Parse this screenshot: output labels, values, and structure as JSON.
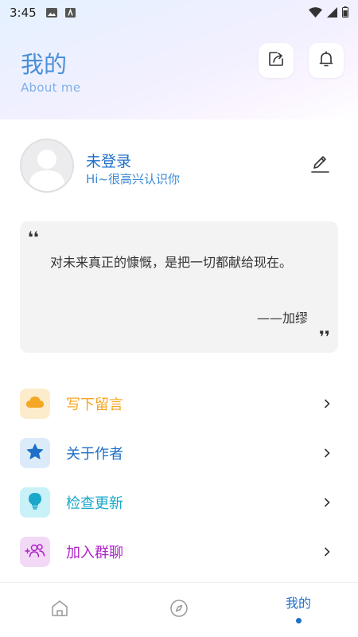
{
  "status_bar": {
    "time": "3:45"
  },
  "header": {
    "title": "我的",
    "subtitle": "About me"
  },
  "profile": {
    "name": "未登录",
    "greeting": "Hi~很高兴认识你"
  },
  "quote": {
    "open_mark": "❛❛",
    "text": "对未来真正的慷慨，是把一切都献给现在。",
    "author": "——加缪",
    "close_mark": "❜❜"
  },
  "menu": {
    "items": [
      {
        "label": "写下留言",
        "icon": "cloud-icon",
        "color": "#f5a623",
        "bg": "#fdeccc"
      },
      {
        "label": "关于作者",
        "icon": "star-icon",
        "color": "#1e6fc7",
        "bg": "#dcebfa"
      },
      {
        "label": "检查更新",
        "icon": "bulb-icon",
        "color": "#1aa7c9",
        "bg": "#c9f1f8"
      },
      {
        "label": "加入群聊",
        "icon": "group-icon",
        "color": "#b023c9",
        "bg": "#f2d9f6"
      }
    ]
  },
  "bottom_nav": {
    "tabs": [
      {
        "icon": "home-icon"
      },
      {
        "icon": "compass-icon"
      },
      {
        "label": "我的",
        "active": true
      }
    ]
  },
  "colors": {
    "accent": "#1e6fc7",
    "title": "#4a8fd8"
  }
}
